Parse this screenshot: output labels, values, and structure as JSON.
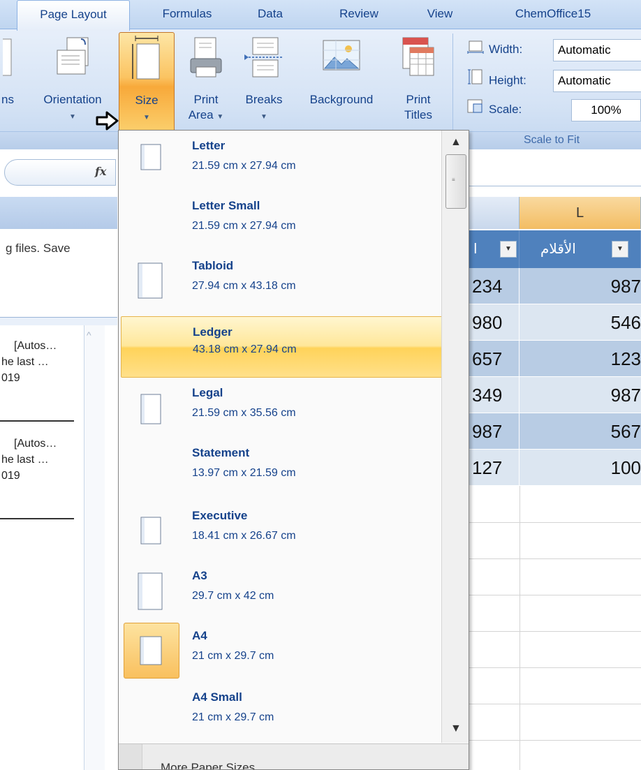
{
  "tabs": [
    {
      "label": "Page Layout",
      "active": true
    },
    {
      "label": "Formulas"
    },
    {
      "label": "Data"
    },
    {
      "label": "Review"
    },
    {
      "label": "View"
    },
    {
      "label": "ChemOffice15"
    }
  ],
  "ribbon": {
    "margins_label": "ns",
    "orientation_label": "Orientation",
    "size_label": "Size",
    "print_area_label": "Print",
    "print_area_label2": "Area",
    "breaks_label": "Breaks",
    "background_label": "Background",
    "print_titles_label": "Print",
    "print_titles_label2": "Titles",
    "scale_to_fit": {
      "width_label": "Width:",
      "width_value": "Automatic",
      "height_label": "Height:",
      "height_value": "Automatic",
      "scale_label": "Scale:",
      "scale_value": "100%",
      "group_label": "Scale to Fit"
    }
  },
  "formula_bar": {
    "fx": "fx"
  },
  "left_pane": {
    "text": "g files.  Save",
    "items": [
      {
        "line1": "[Autos…",
        "line2": "he last …",
        "line3": "019"
      },
      {
        "line1": "[Autos…",
        "line2": "he last …",
        "line3": "019"
      }
    ]
  },
  "grid": {
    "col_k": "",
    "col_l": "L",
    "header_k": "ا",
    "header_l": "الأقلام",
    "rows": [
      {
        "k": "234",
        "l": "987"
      },
      {
        "k": "980",
        "l": "546"
      },
      {
        "k": "657",
        "l": "123"
      },
      {
        "k": "349",
        "l": "987"
      },
      {
        "k": "987",
        "l": "567"
      },
      {
        "k": "127",
        "l": "100"
      }
    ]
  },
  "size_menu": {
    "items": [
      {
        "name": "Letter",
        "dims": "21.59 cm x 27.94 cm",
        "icon": "page-portrait"
      },
      {
        "name": "Letter Small",
        "dims": "21.59 cm x 27.94 cm",
        "icon": "none"
      },
      {
        "name": "Tabloid",
        "dims": "27.94 cm x 43.18 cm",
        "icon": "page-portrait-large"
      },
      {
        "name": "Ledger",
        "dims": "43.18 cm x 27.94 cm",
        "icon": "none",
        "hover": true
      },
      {
        "name": "Legal",
        "dims": "21.59 cm x 35.56 cm",
        "icon": "page-portrait-tall"
      },
      {
        "name": "Statement",
        "dims": "13.97 cm x 21.59 cm",
        "icon": "none"
      },
      {
        "name": "Executive",
        "dims": "18.41 cm x 26.67 cm",
        "icon": "page-portrait"
      },
      {
        "name": "A3",
        "dims": "29.7 cm x 42 cm",
        "icon": "page-portrait-large"
      },
      {
        "name": "A4",
        "dims": "21 cm x 29.7 cm",
        "icon": "page-portrait",
        "selected": true
      },
      {
        "name": "A4 Small",
        "dims": "21 cm x 29.7 cm",
        "icon": "none"
      }
    ],
    "footer_label": "More Paper Sizes..."
  },
  "colors": {
    "ribbon_text": "#15428b",
    "selected_orange": "#f9c05e",
    "table_header_blue": "#4f81bd",
    "band_dark": "#b8cce4",
    "band_light": "#dce6f1"
  }
}
